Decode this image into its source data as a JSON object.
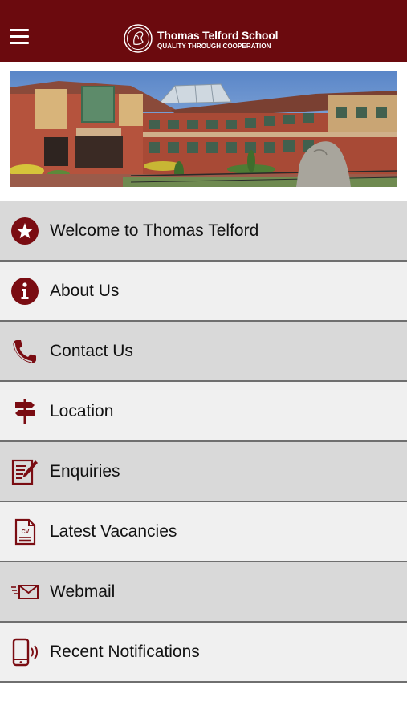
{
  "header": {
    "menu_icon": "hamburger-menu-icon",
    "logo_crest_icon": "school-crest-icon",
    "title": "Thomas Telford School",
    "tagline": "QUALITY THROUGH COOPERATION",
    "background_color": "#6b0a0e"
  },
  "hero": {
    "image": "school-building-photo"
  },
  "menu": {
    "accent_color": "#7a0c12",
    "items": [
      {
        "label": "Welcome to Thomas Telford",
        "icon": "star-circle-icon"
      },
      {
        "label": "About Us",
        "icon": "info-circle-icon"
      },
      {
        "label": "Contact Us",
        "icon": "phone-icon"
      },
      {
        "label": "Location",
        "icon": "signpost-icon"
      },
      {
        "label": "Enquiries",
        "icon": "edit-form-icon"
      },
      {
        "label": "Latest Vacancies",
        "icon": "cv-document-icon"
      },
      {
        "label": "Webmail",
        "icon": "email-icon"
      },
      {
        "label": "Recent Notifications",
        "icon": "mobile-notification-icon"
      }
    ]
  }
}
